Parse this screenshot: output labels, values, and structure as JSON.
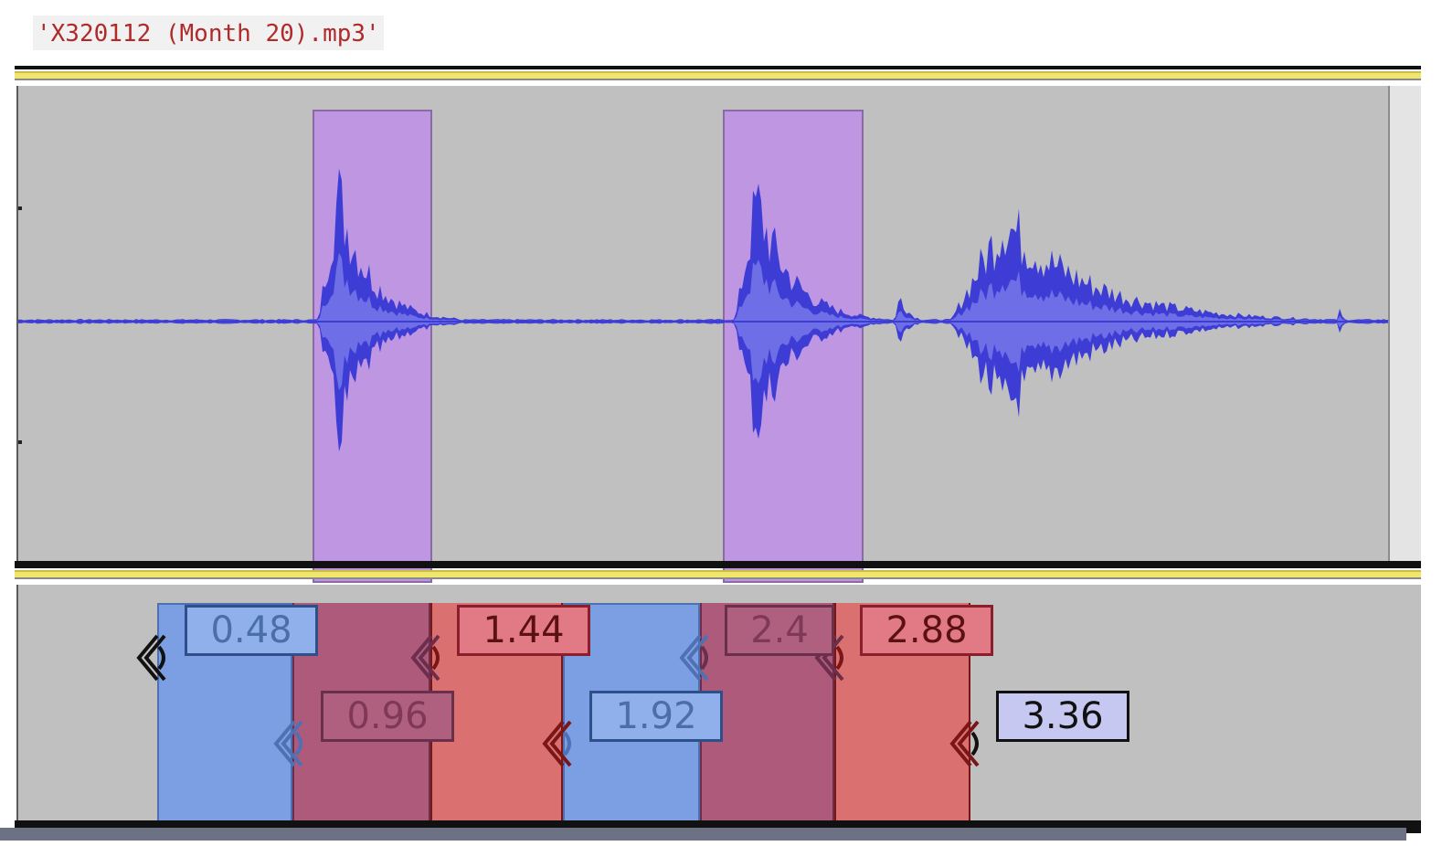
{
  "file": {
    "name": "'X320112 (Month 20).mp3'"
  },
  "audio_track": {
    "selections": [
      {
        "name": "selection-1"
      },
      {
        "name": "selection-2"
      }
    ]
  },
  "label_track": {
    "labels": [
      {
        "value": "0.48",
        "style": "blue"
      },
      {
        "value": "0.96",
        "style": "purple"
      },
      {
        "value": "1.44",
        "style": "red"
      },
      {
        "value": "1.92",
        "style": "blue"
      },
      {
        "value": "2.4",
        "style": "purple"
      },
      {
        "value": "2.88",
        "style": "red"
      },
      {
        "value": "3.36",
        "style": "lavender"
      }
    ]
  },
  "colors": {
    "waveform": "#3d3dd6",
    "waveform_rms": "#6e6ee6",
    "selection": "#bf96e2",
    "track_bg": "#c0c0c0",
    "label_blue": "#7b9fe2",
    "label_purple": "#ad5a7b",
    "label_red": "#db7070",
    "label_lavender": "#c6c8f2",
    "track_header": "#f2e56b"
  }
}
